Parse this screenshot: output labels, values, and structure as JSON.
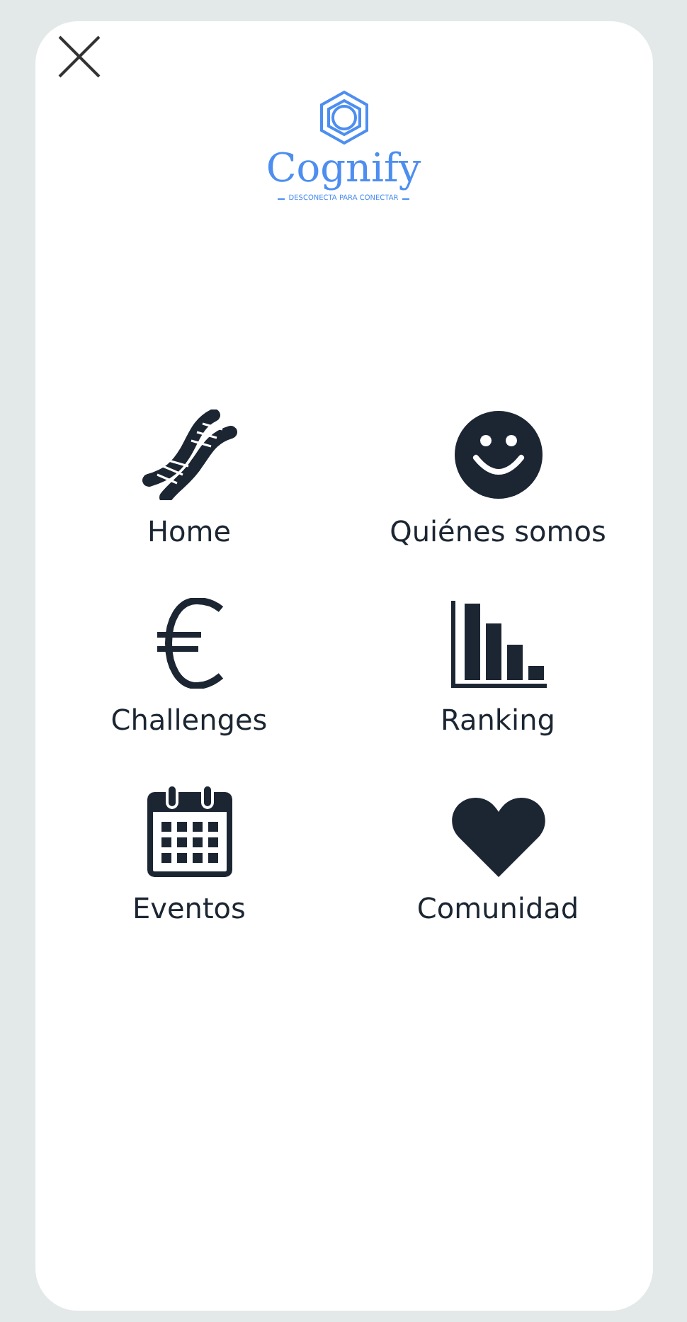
{
  "logo": {
    "name": "Cognify",
    "tagline": "DESCONECTA PARA CONECTAR"
  },
  "menu": [
    {
      "kind": "dna",
      "label": "Home"
    },
    {
      "kind": "smile",
      "label": "Quiénes somos"
    },
    {
      "kind": "euro",
      "label": "Challenges"
    },
    {
      "kind": "bars",
      "label": "Ranking"
    },
    {
      "kind": "calendar",
      "label": "Eventos"
    },
    {
      "kind": "heart",
      "label": "Comunidad"
    }
  ]
}
